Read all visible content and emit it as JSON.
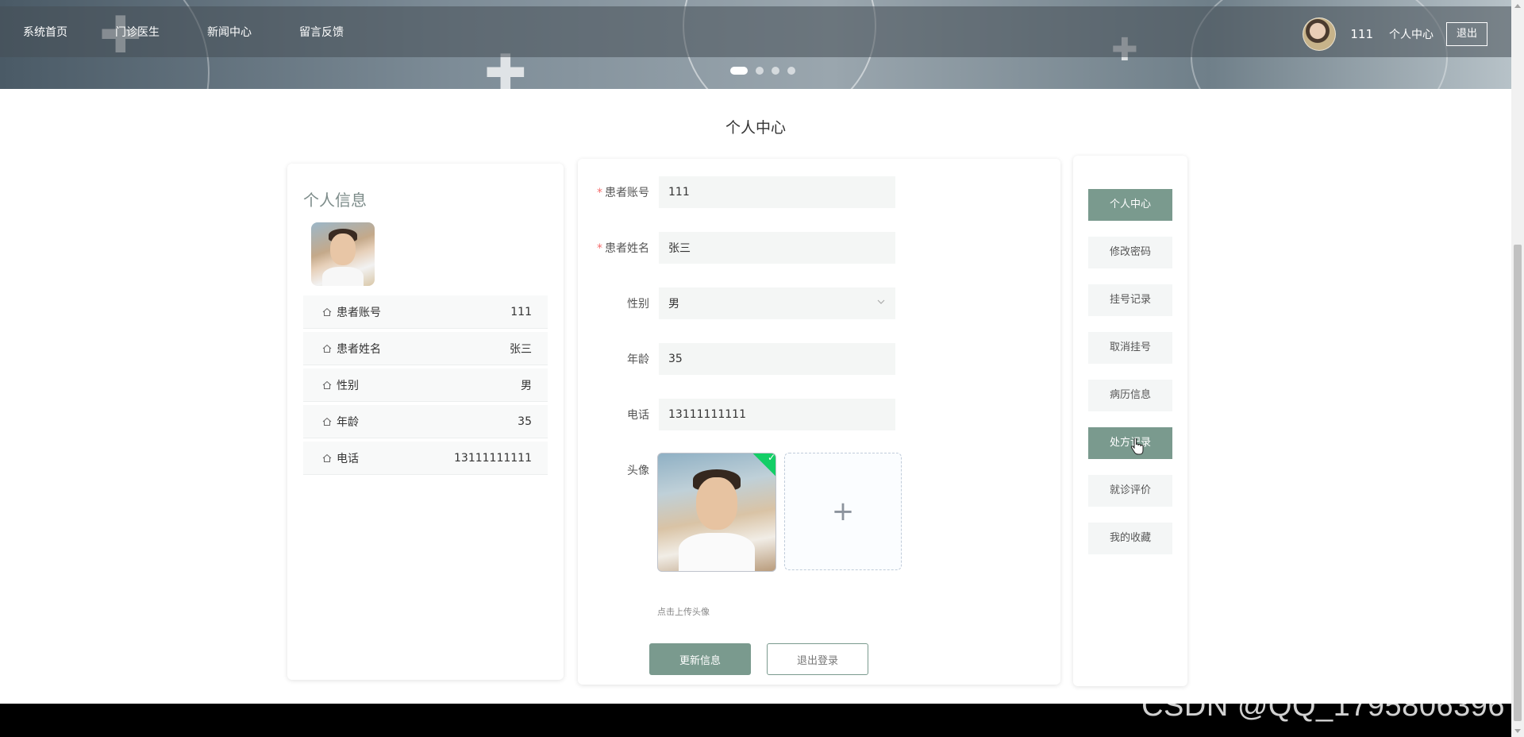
{
  "nav": {
    "items": [
      "系统首页",
      "门诊医生",
      "新闻中心",
      "留言反馈"
    ],
    "username": "111",
    "profile_link": "个人中心",
    "logout": "退出"
  },
  "page_title": "个人中心",
  "profile_card": {
    "title": "个人信息",
    "rows": [
      {
        "label": "患者账号",
        "value": "111"
      },
      {
        "label": "患者姓名",
        "value": "张三"
      },
      {
        "label": "性别",
        "value": "男"
      },
      {
        "label": "年龄",
        "value": "35"
      },
      {
        "label": "电话",
        "value": "13111111111"
      }
    ]
  },
  "form": {
    "account": {
      "label": "患者账号",
      "value": "111"
    },
    "name": {
      "label": "患者姓名",
      "value": "张三"
    },
    "gender": {
      "label": "性别",
      "value": "男"
    },
    "age": {
      "label": "年龄",
      "value": "35"
    },
    "phone": {
      "label": "电话",
      "value": "13111111111"
    },
    "avatar": {
      "label": "头像",
      "tip": "点击上传头像",
      "add_glyph": "+"
    },
    "update_button": "更新信息",
    "logout_button": "退出登录"
  },
  "side_menu": {
    "items": [
      "个人中心",
      "修改密码",
      "挂号记录",
      "取消挂号",
      "病历信息",
      "处方记录",
      "就诊评价",
      "我的收藏"
    ],
    "active": [
      "个人中心",
      "处方记录"
    ]
  },
  "watermark": "CSDN @QQ_1795806396",
  "colors": {
    "accent": "#7a9a8e",
    "required": "#f56c6c",
    "upload_success": "#13ce66"
  }
}
